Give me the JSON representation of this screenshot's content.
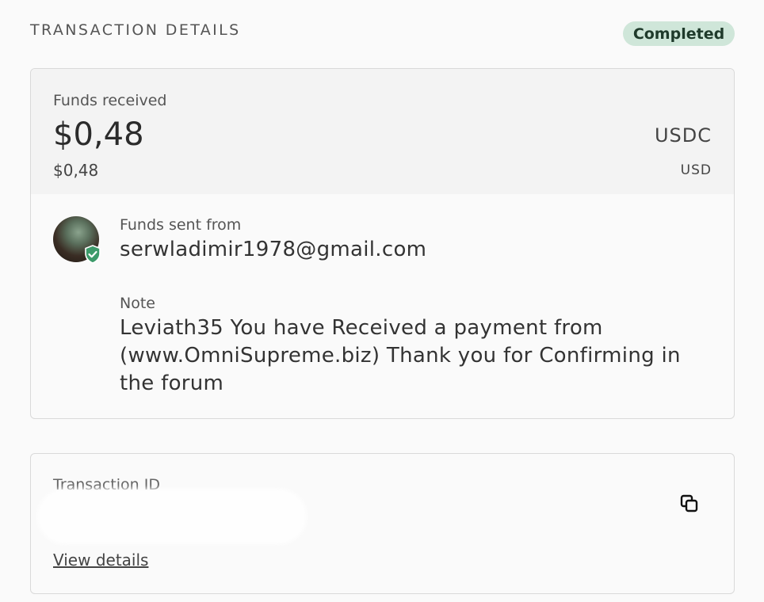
{
  "header": {
    "title": "TRANSACTION DETAILS",
    "status": "Completed",
    "status_color": "#cfe6d9"
  },
  "amount": {
    "label": "Funds received",
    "primary": "$0,48",
    "primary_currency": "USDC",
    "secondary": "$0,48",
    "secondary_currency": "USD"
  },
  "sender": {
    "avatar_icon": "user-avatar",
    "verified_icon": "shield-check-icon",
    "label": "Funds sent from",
    "email": "serwladimir1978@gmail.com"
  },
  "note": {
    "label": "Note",
    "text": "Leviath35 You have Received a payment from (www.OmniSupreme.biz) Thank you for Confirming in the forum"
  },
  "transaction": {
    "id_label": "Transaction ID",
    "copy_icon": "copy-icon",
    "view_details": "View details"
  }
}
